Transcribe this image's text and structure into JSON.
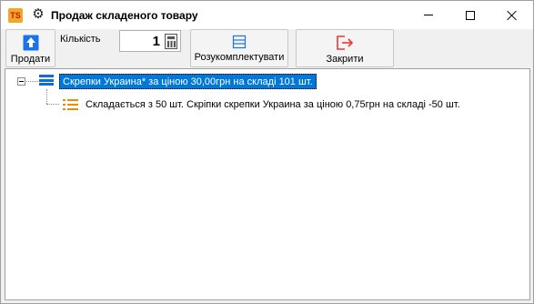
{
  "window": {
    "logo_text": "TS",
    "title": "Продаж складеного товару"
  },
  "toolbar": {
    "sell_label": "Продати",
    "quantity_label": "Кількість",
    "quantity_value": "1",
    "disassemble_label": "Розукомплектувати",
    "close_label": "Закрити"
  },
  "tree": {
    "root": {
      "label": "Скрепки Украина* за ціною 30,00грн на складі 101 шт.",
      "expanded": true,
      "selected": true,
      "children": [
        {
          "label": "Складається з 50 шт. Скріпки скрепки Украина за ціною 0,75грн на складі -50 шт."
        }
      ]
    }
  },
  "colors": {
    "accent": "#0078d7",
    "sell_icon": "#1a73e8",
    "close_icon": "#e53935",
    "component_icon": "#f08a00"
  }
}
